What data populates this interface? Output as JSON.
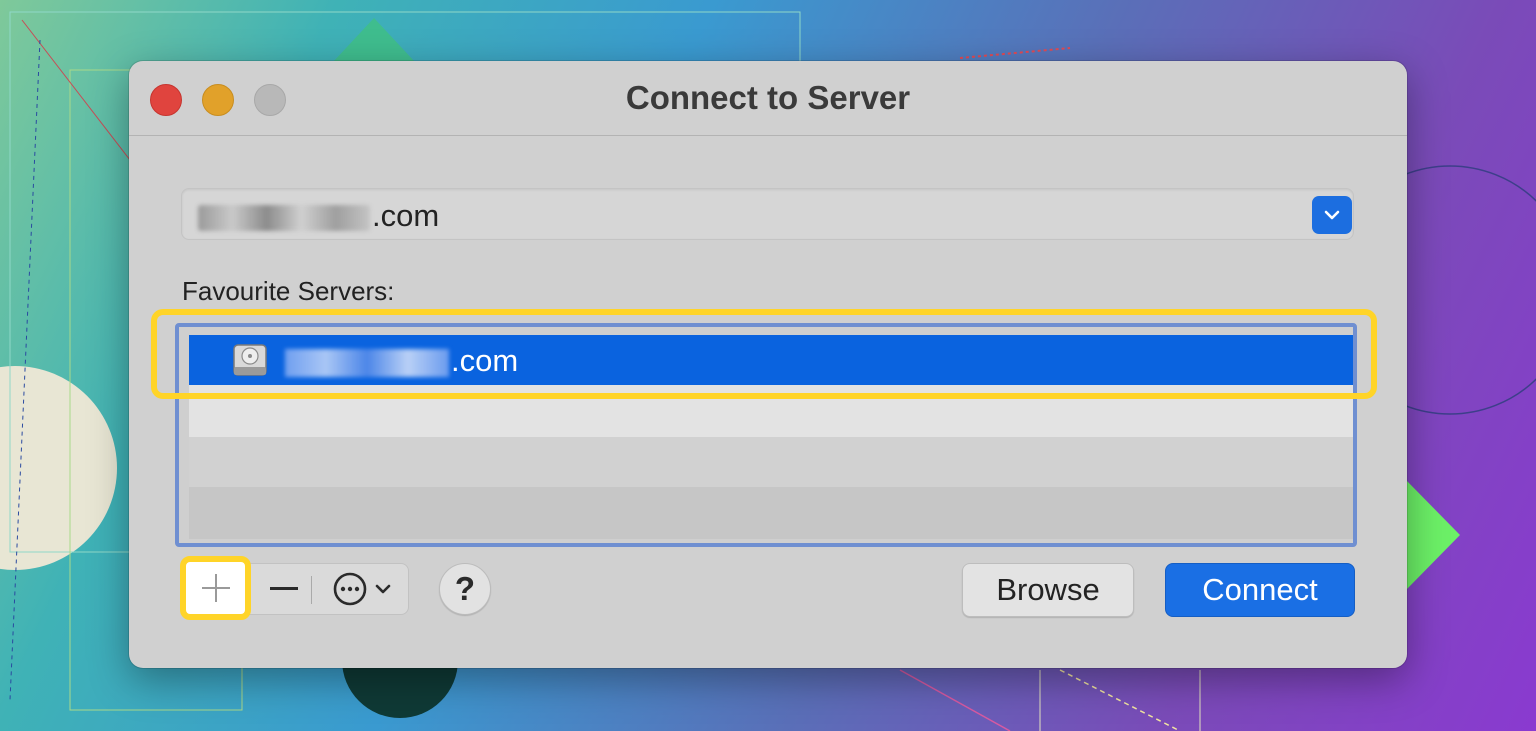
{
  "window": {
    "title": "Connect to Server"
  },
  "server_address": {
    "visible_suffix": ".com"
  },
  "favourites": {
    "label": "Favourite Servers:",
    "items": [
      {
        "visible_suffix": ".com",
        "selected": true
      }
    ]
  },
  "toolbar": {
    "add_label": "+",
    "remove_label": "—",
    "help_label": "?"
  },
  "buttons": {
    "browse_label": "Browse",
    "connect_label": "Connect"
  },
  "colors": {
    "accent": "#1a6fe4",
    "highlight": "#ffd428",
    "selection": "#0a63df"
  },
  "icons": {
    "dropdown": "chevron-down-icon",
    "server": "hard-drive-icon",
    "more": "ellipsis-circle-icon"
  }
}
